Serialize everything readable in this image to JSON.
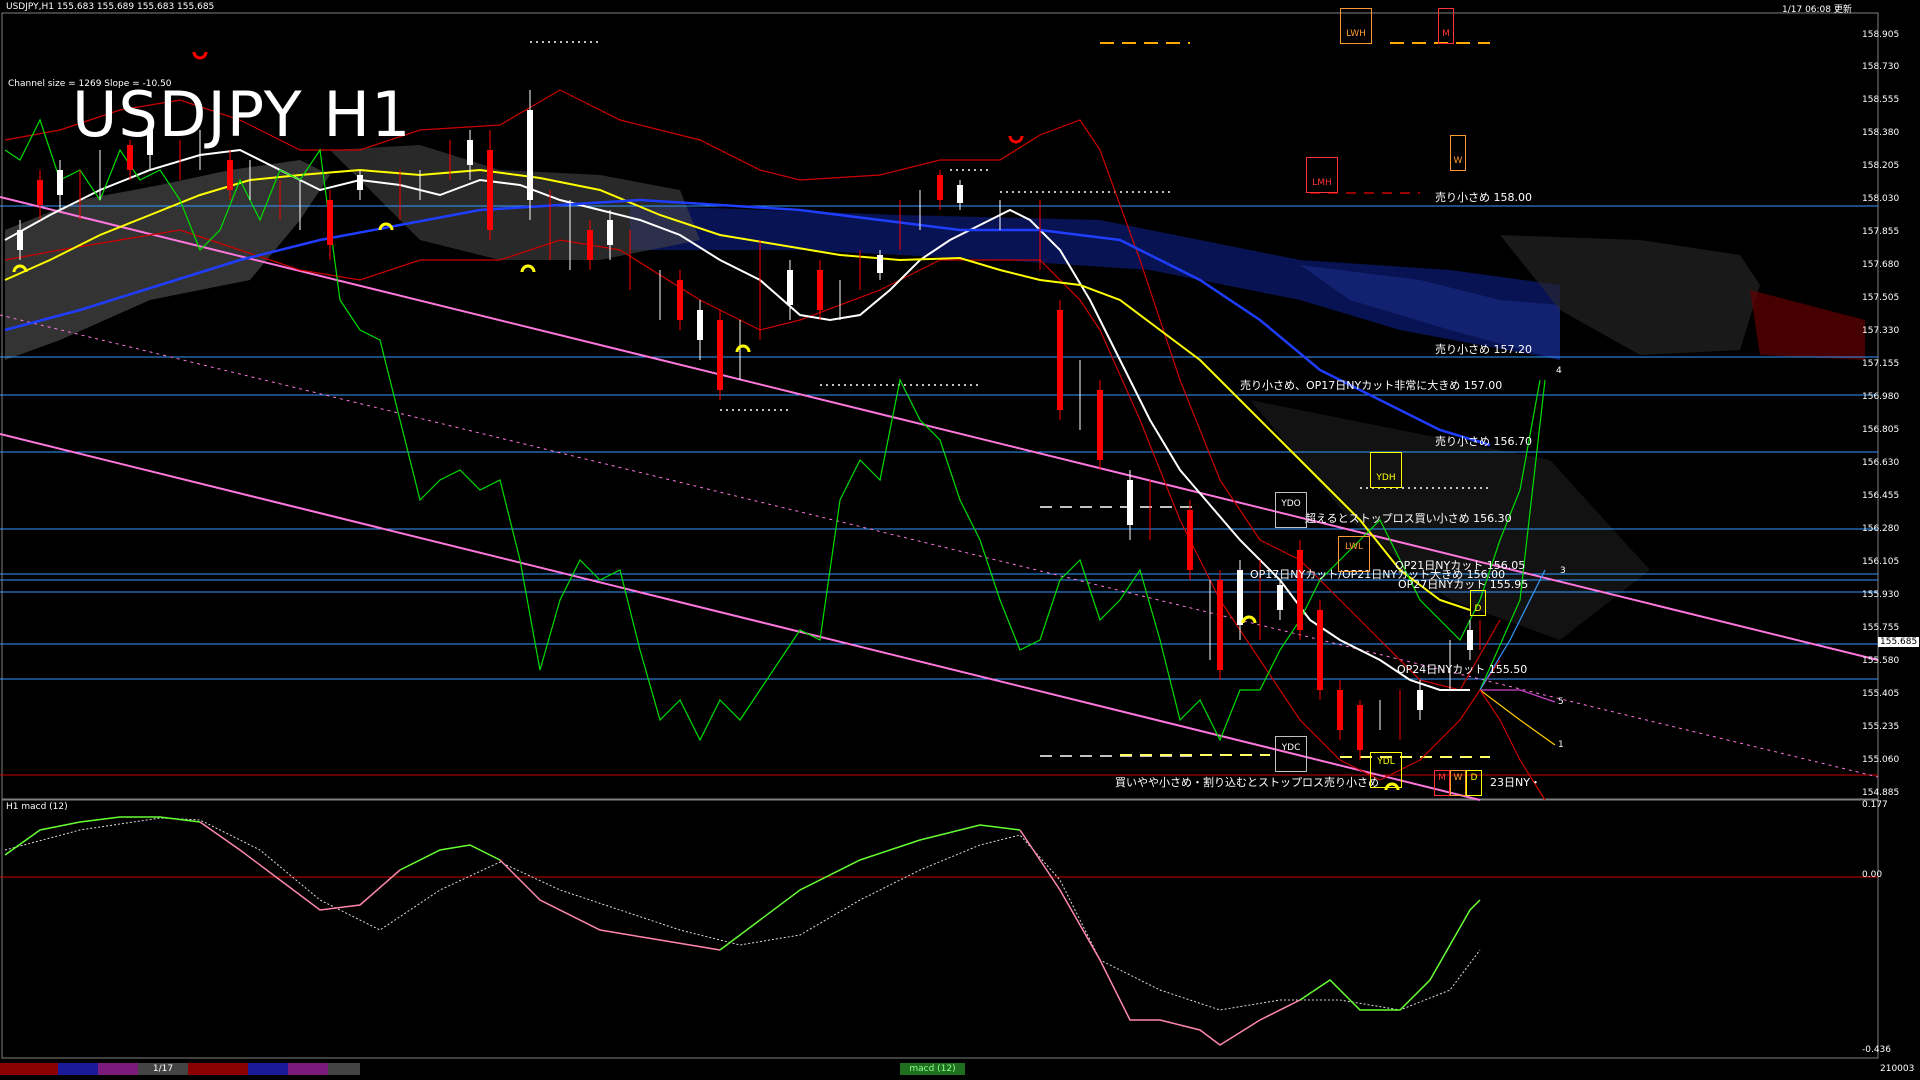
{
  "header": {
    "symbol_info": "USDJPY,H1  155.683 155.689 155.683 155.685",
    "timestamp": "1/17 06:08 更新",
    "channel_info": "Channel size = 1269 Slope = -10.50",
    "title": "USDJPY H1"
  },
  "price_axis": [
    "158.905",
    "158.730",
    "158.555",
    "158.380",
    "158.205",
    "158.030",
    "157.855",
    "157.680",
    "157.505",
    "157.330",
    "157.155",
    "156.980",
    "156.805",
    "156.630",
    "156.455",
    "156.280",
    "156.105",
    "155.930",
    "155.755",
    "155.580",
    "155.405",
    "155.235",
    "155.060",
    "154.885"
  ],
  "current_price": "155.685",
  "levels": [
    {
      "label": "売り小さめ 158.00"
    },
    {
      "label": "売り小さめ 157.20"
    },
    {
      "label": "売り小さめ、OP17日NYカット非常に大きめ 157.00"
    },
    {
      "label": "売り小さめ 156.70"
    },
    {
      "label": "超えるとストップロス買い小さめ 156.30"
    },
    {
      "label": "OP21日NYカット 156.05"
    },
    {
      "label": "OP17日NYカット/OP21日NYカット大きめ 156.00"
    },
    {
      "label": "OP27日NYカット 155.95"
    },
    {
      "label": "OP24日NYカット 155.50"
    },
    {
      "label": "買いやや小さめ・割り込むとストップロス売り小さめ"
    },
    {
      "label": "23日NY・"
    }
  ],
  "tags": [
    "LWH",
    "M",
    "W",
    "LMH",
    "YDH",
    "YDO",
    "LWL",
    "D",
    "YDC",
    "YDL",
    "M",
    "W",
    "D"
  ],
  "projection_labels": [
    "4",
    "3",
    "5",
    "1"
  ],
  "macd": {
    "title": "H1  macd (12)",
    "axis": [
      "0.177",
      "0.00",
      "-0.436"
    ]
  },
  "bottom_bar": {
    "date_label": "1/17",
    "indicator_tab": "macd (12)",
    "right_value": "210003"
  },
  "colors": {
    "background": "#000000",
    "up_candle": "#ffffff",
    "down_candle": "#ff0000",
    "ma_white": "#ffffff",
    "ma_yellow": "#ffff00",
    "ma_blue": "#0000ff",
    "bollinger": "#cc0000",
    "green_line": "#00ff00",
    "channel": "#ff66cc",
    "level_line": "#3399ff",
    "cloud": "#3355ff"
  }
}
